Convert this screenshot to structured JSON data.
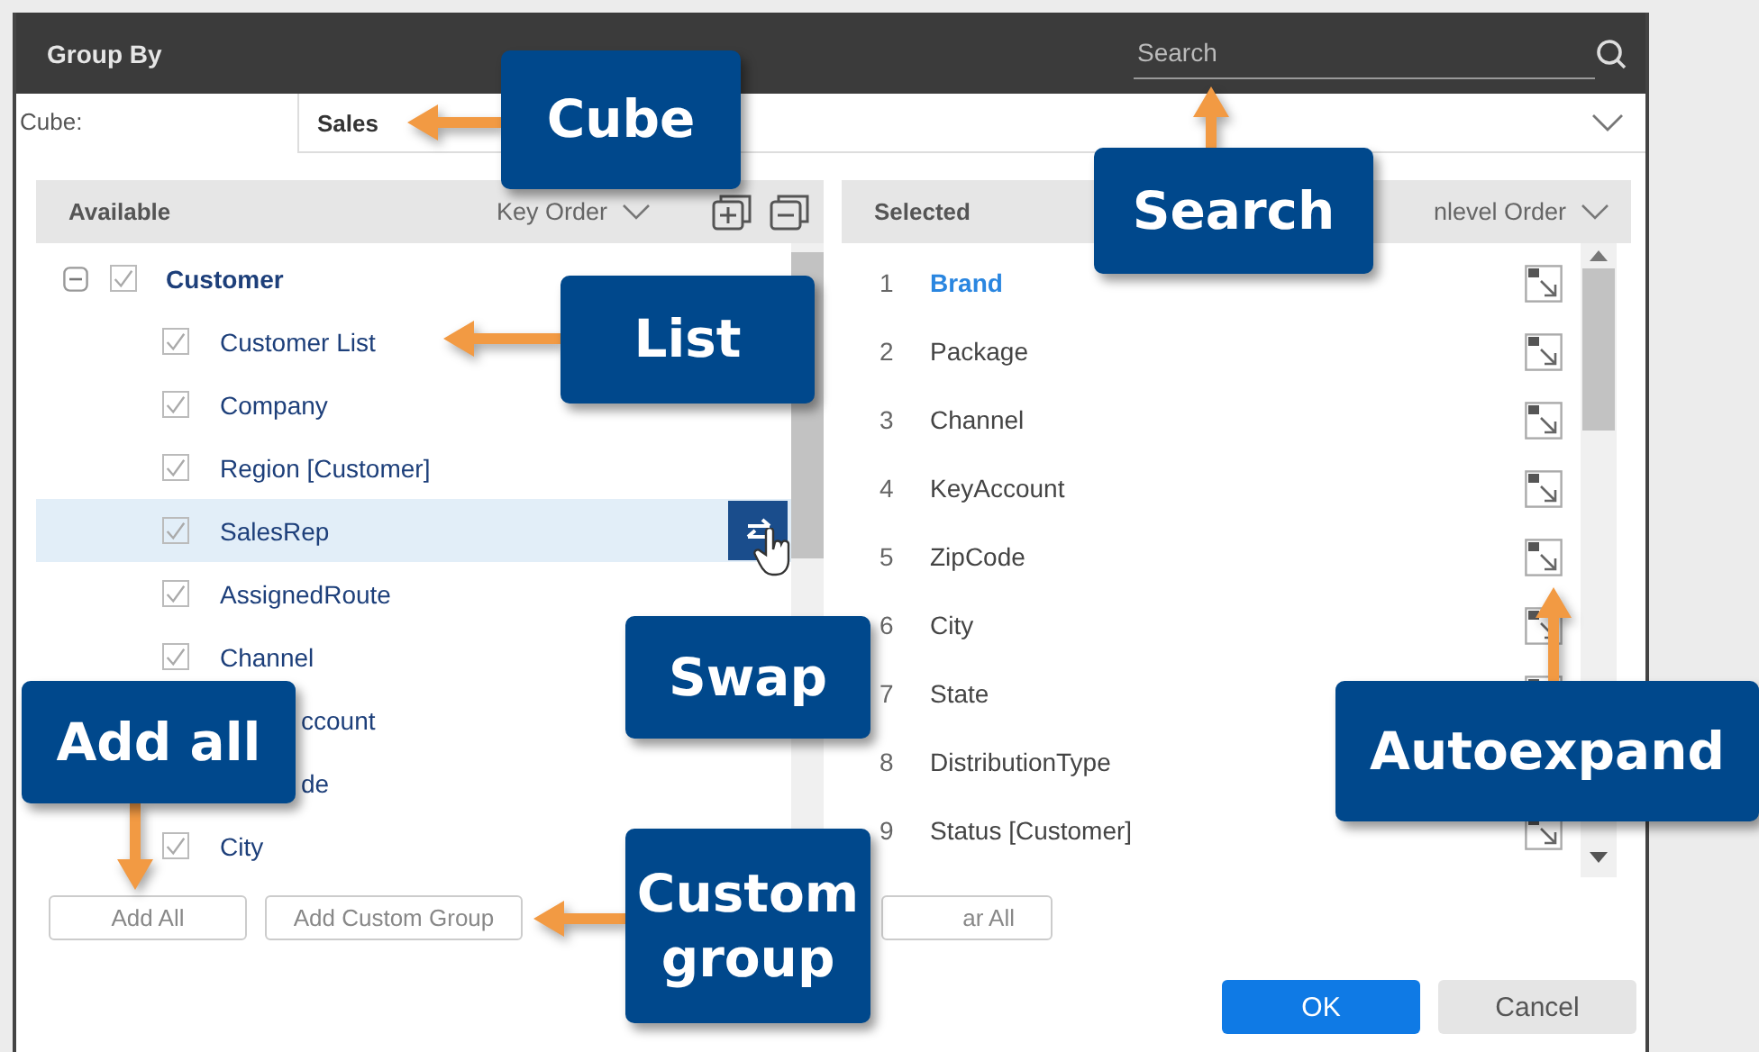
{
  "window": {
    "title": "Group By"
  },
  "search": {
    "placeholder": "Search"
  },
  "cube": {
    "label": "Cube:",
    "value": "Sales"
  },
  "available": {
    "title": "Available",
    "sort": "Key Order",
    "tree": [
      {
        "label": "Customer",
        "checked": true,
        "expanded": true,
        "children": [
          {
            "label": "Customer List",
            "kind": "item",
            "checked": true,
            "selected": false
          },
          {
            "label": "Company",
            "kind": "item",
            "checked": true,
            "selected": false
          },
          {
            "label": "Region [Customer]",
            "kind": "item",
            "checked": true,
            "selected": false
          },
          {
            "label": "SalesRep",
            "kind": "item",
            "checked": true,
            "selected": true
          },
          {
            "label": "AssignedRoute",
            "kind": "item",
            "checked": true,
            "selected": false
          },
          {
            "label": "Channel",
            "kind": "item",
            "checked": true,
            "selected": false
          },
          {
            "label": "ccount",
            "kind": "clipped",
            "selected": false
          },
          {
            "label": "de",
            "kind": "clipped",
            "selected": false
          },
          {
            "label": "City",
            "kind": "item",
            "checked": true,
            "selected": false
          }
        ]
      }
    ]
  },
  "available_buttons": [
    {
      "label": "Add All"
    },
    {
      "label": "Add Custom Group"
    }
  ],
  "selected_panel": {
    "title": "Selected",
    "sort": "nlevel Order",
    "items": [
      {
        "number": "1",
        "label": "Brand",
        "selected": true
      },
      {
        "number": "2",
        "label": "Package",
        "selected": false
      },
      {
        "number": "3",
        "label": "Channel",
        "selected": false
      },
      {
        "number": "4",
        "label": "KeyAccount",
        "selected": false
      },
      {
        "number": "5",
        "label": "ZipCode",
        "selected": false
      },
      {
        "number": "6",
        "label": "City",
        "selected": false
      },
      {
        "number": "7",
        "label": "State",
        "selected": false
      },
      {
        "number": "8",
        "label": "DistributionType",
        "selected": false
      },
      {
        "number": "9",
        "label": "Status [Customer]",
        "selected": false
      }
    ],
    "clear_button": {
      "label": "ar All"
    }
  },
  "dialog_buttons": [
    {
      "label": "OK",
      "kind": "primary"
    },
    {
      "label": "Cancel",
      "kind": "secondary"
    }
  ],
  "callouts": [
    {
      "label": "Cube"
    },
    {
      "label": "Search"
    },
    {
      "label": "List"
    },
    {
      "label": "Swap"
    },
    {
      "label": "Add all"
    },
    {
      "label": "Custom group"
    },
    {
      "label": "Autoexpand"
    }
  ]
}
